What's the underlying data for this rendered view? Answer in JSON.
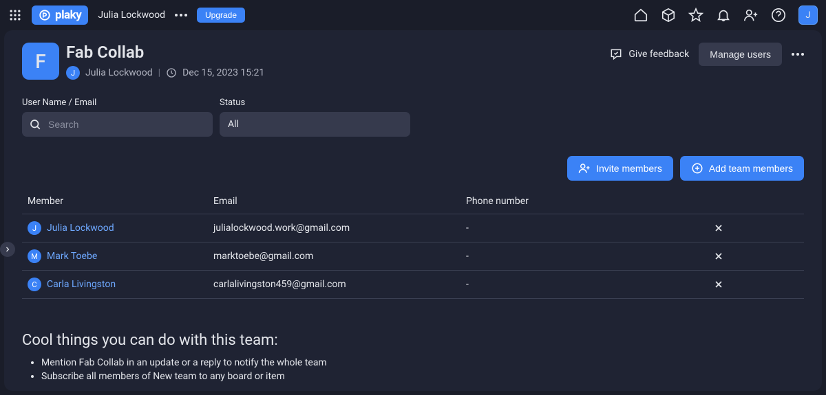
{
  "topbar": {
    "logo_text": "plaky",
    "user_name": "Julia Lockwood",
    "upgrade_label": "Upgrade",
    "avatar_initial": "J"
  },
  "header": {
    "team_avatar_initial": "F",
    "team_title": "Fab Collab",
    "owner_avatar_initial": "J",
    "owner_name": "Julia Lockwood",
    "timestamp": "Dec 15, 2023 15:21",
    "feedback_label": "Give feedback",
    "manage_label": "Manage users"
  },
  "filters": {
    "search_label": "User Name / Email",
    "search_placeholder": "Search",
    "status_label": "Status",
    "status_value": "All"
  },
  "actions": {
    "invite_label": "Invite members",
    "add_label": "Add team members"
  },
  "table": {
    "col_member": "Member",
    "col_email": "Email",
    "col_phone": "Phone number",
    "rows": [
      {
        "initial": "J",
        "name": "Julia Lockwood",
        "email": "julialockwood.work@gmail.com",
        "phone": "-"
      },
      {
        "initial": "M",
        "name": "Mark Toebe",
        "email": "marktoebe@gmail.com",
        "phone": "-"
      },
      {
        "initial": "C",
        "name": "Carla Livingston",
        "email": "carlalivingston459@gmail.com",
        "phone": "-"
      }
    ]
  },
  "tips": {
    "title": "Cool things you can do with this team:",
    "items": [
      "Mention Fab Collab in an update or a reply to notify the whole team",
      "Subscribe all members of New team to any board or item"
    ]
  }
}
